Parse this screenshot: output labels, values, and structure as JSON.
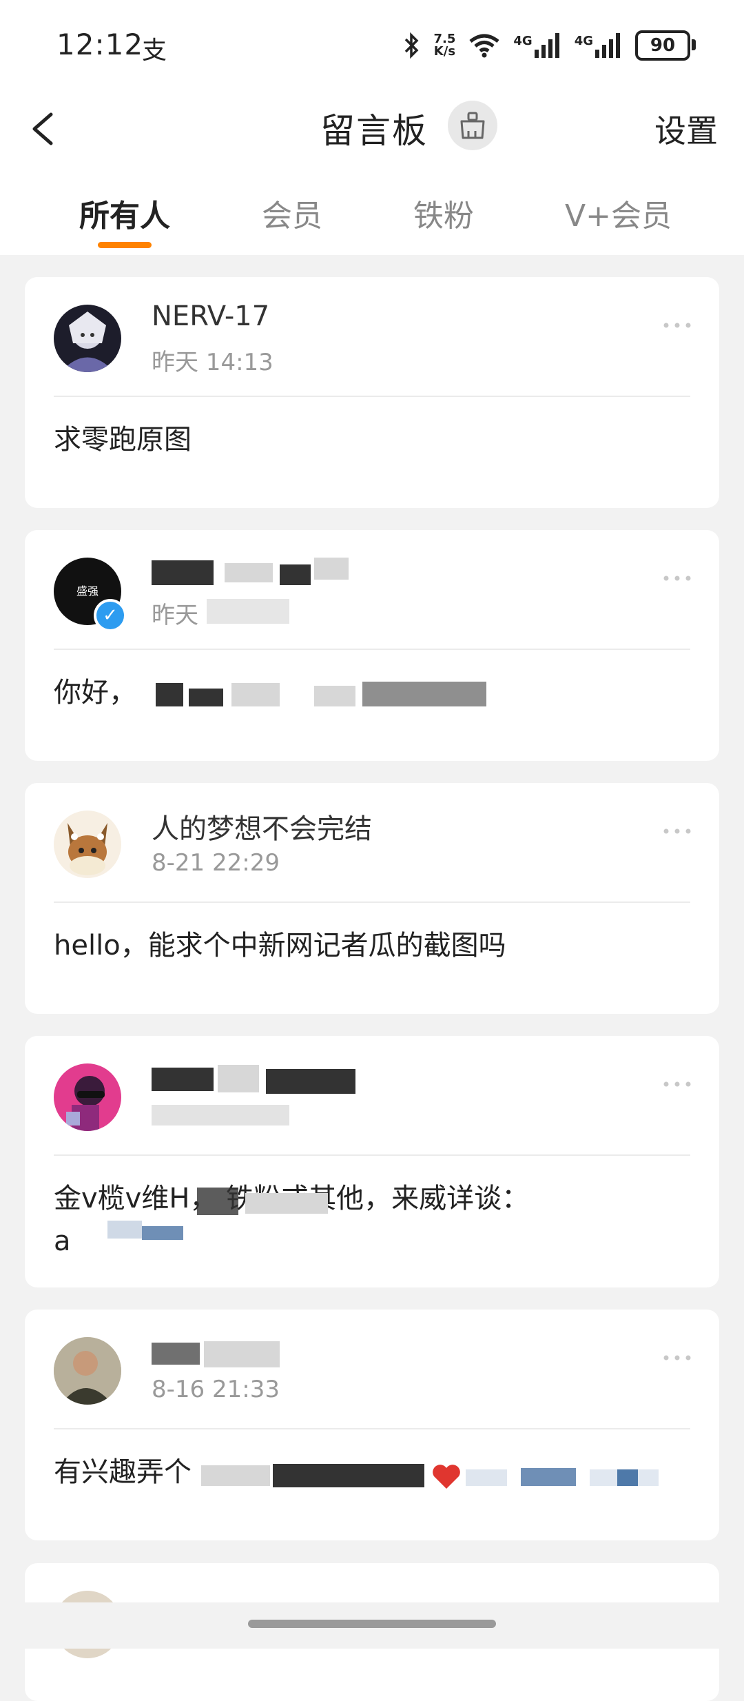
{
  "status_bar": {
    "time": "12:12",
    "app_icon": "支",
    "net_speed": "7.5\nK/s",
    "net1": "4G",
    "net2": "4G",
    "battery": "90",
    "icons": [
      "bluetooth-icon",
      "wifi-icon",
      "signal-icon",
      "signal-icon",
      "battery-icon"
    ]
  },
  "header": {
    "title": "留言板",
    "settings_label": "设置",
    "back_icon": "chevron-left-icon",
    "brush_icon": "brush-icon"
  },
  "tabs": {
    "items": [
      {
        "label": "所有人",
        "active": true
      },
      {
        "label": "会员",
        "active": false
      },
      {
        "label": "铁粉",
        "active": false
      },
      {
        "label": "V+会员",
        "active": false
      }
    ],
    "accent_color": "#ff8200"
  },
  "messages": [
    {
      "name": "NERV-17",
      "time": "昨天 14:13",
      "content": "求零跑原图"
    },
    {
      "name": "",
      "avatar_text": "盛强",
      "time": "昨天",
      "content": "你好，"
    },
    {
      "name": "人的梦想不会完结",
      "time": "8-21 22:29",
      "content": "hello，能求个中新网记者瓜的截图吗"
    },
    {
      "name": "",
      "time": "",
      "content": "金v榄v维H，  铁粉或其他，来威详谈：",
      "content2": "a"
    },
    {
      "name": "",
      "time": "8-16 21:33",
      "content": "有兴趣弄个"
    },
    {
      "name": "",
      "time": "",
      "content": ""
    }
  ]
}
